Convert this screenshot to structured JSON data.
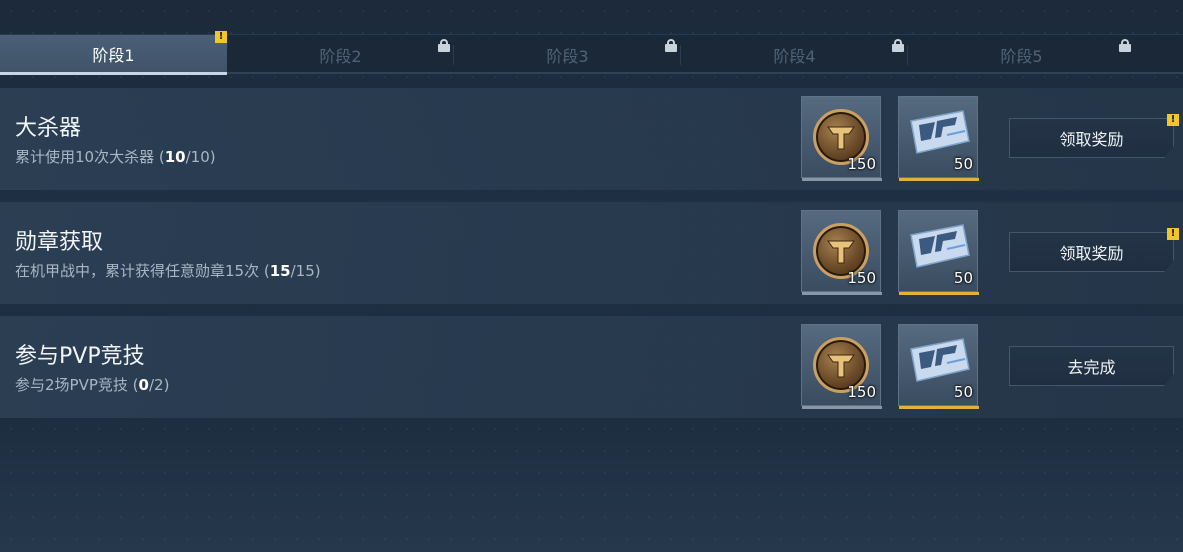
{
  "tabs": [
    {
      "label": "阶段1",
      "active": true,
      "alert": true
    },
    {
      "label": "阶段2",
      "locked": true
    },
    {
      "label": "阶段3",
      "locked": true
    },
    {
      "label": "阶段4",
      "locked": true
    },
    {
      "label": "阶段5",
      "locked": true
    }
  ],
  "tasks": [
    {
      "title": "大杀器",
      "desc_prefix": "累计使用10次大杀器 (",
      "progress_current": "10",
      "progress_suffix": "/10)",
      "reward1_qty": "150",
      "reward2_qty": "50",
      "button": "领取奖励",
      "alert": true
    },
    {
      "title": "勋章获取",
      "desc_prefix": "在机甲战中，累计获得任意勋章15次 (",
      "progress_current": "15",
      "progress_suffix": "/15)",
      "reward1_qty": "150",
      "reward2_qty": "50",
      "button": "领取奖励",
      "alert": true
    },
    {
      "title": "参与PVP竞技",
      "desc_prefix": "参与2场PVP竞技 (",
      "progress_current": "0",
      "progress_suffix": "/2)",
      "reward1_qty": "150",
      "reward2_qty": "50",
      "button": "去完成",
      "alert": false
    }
  ],
  "icons": {
    "reward1": "gold-emblem-coin-icon",
    "reward2": "blue-ticket-icon",
    "lock": "lock-icon",
    "alert": "exclamation-badge-icon"
  },
  "colors": {
    "alert": "#f1c62b",
    "gold_bar": "#e0b23a",
    "active_tab": "#4b6078"
  }
}
